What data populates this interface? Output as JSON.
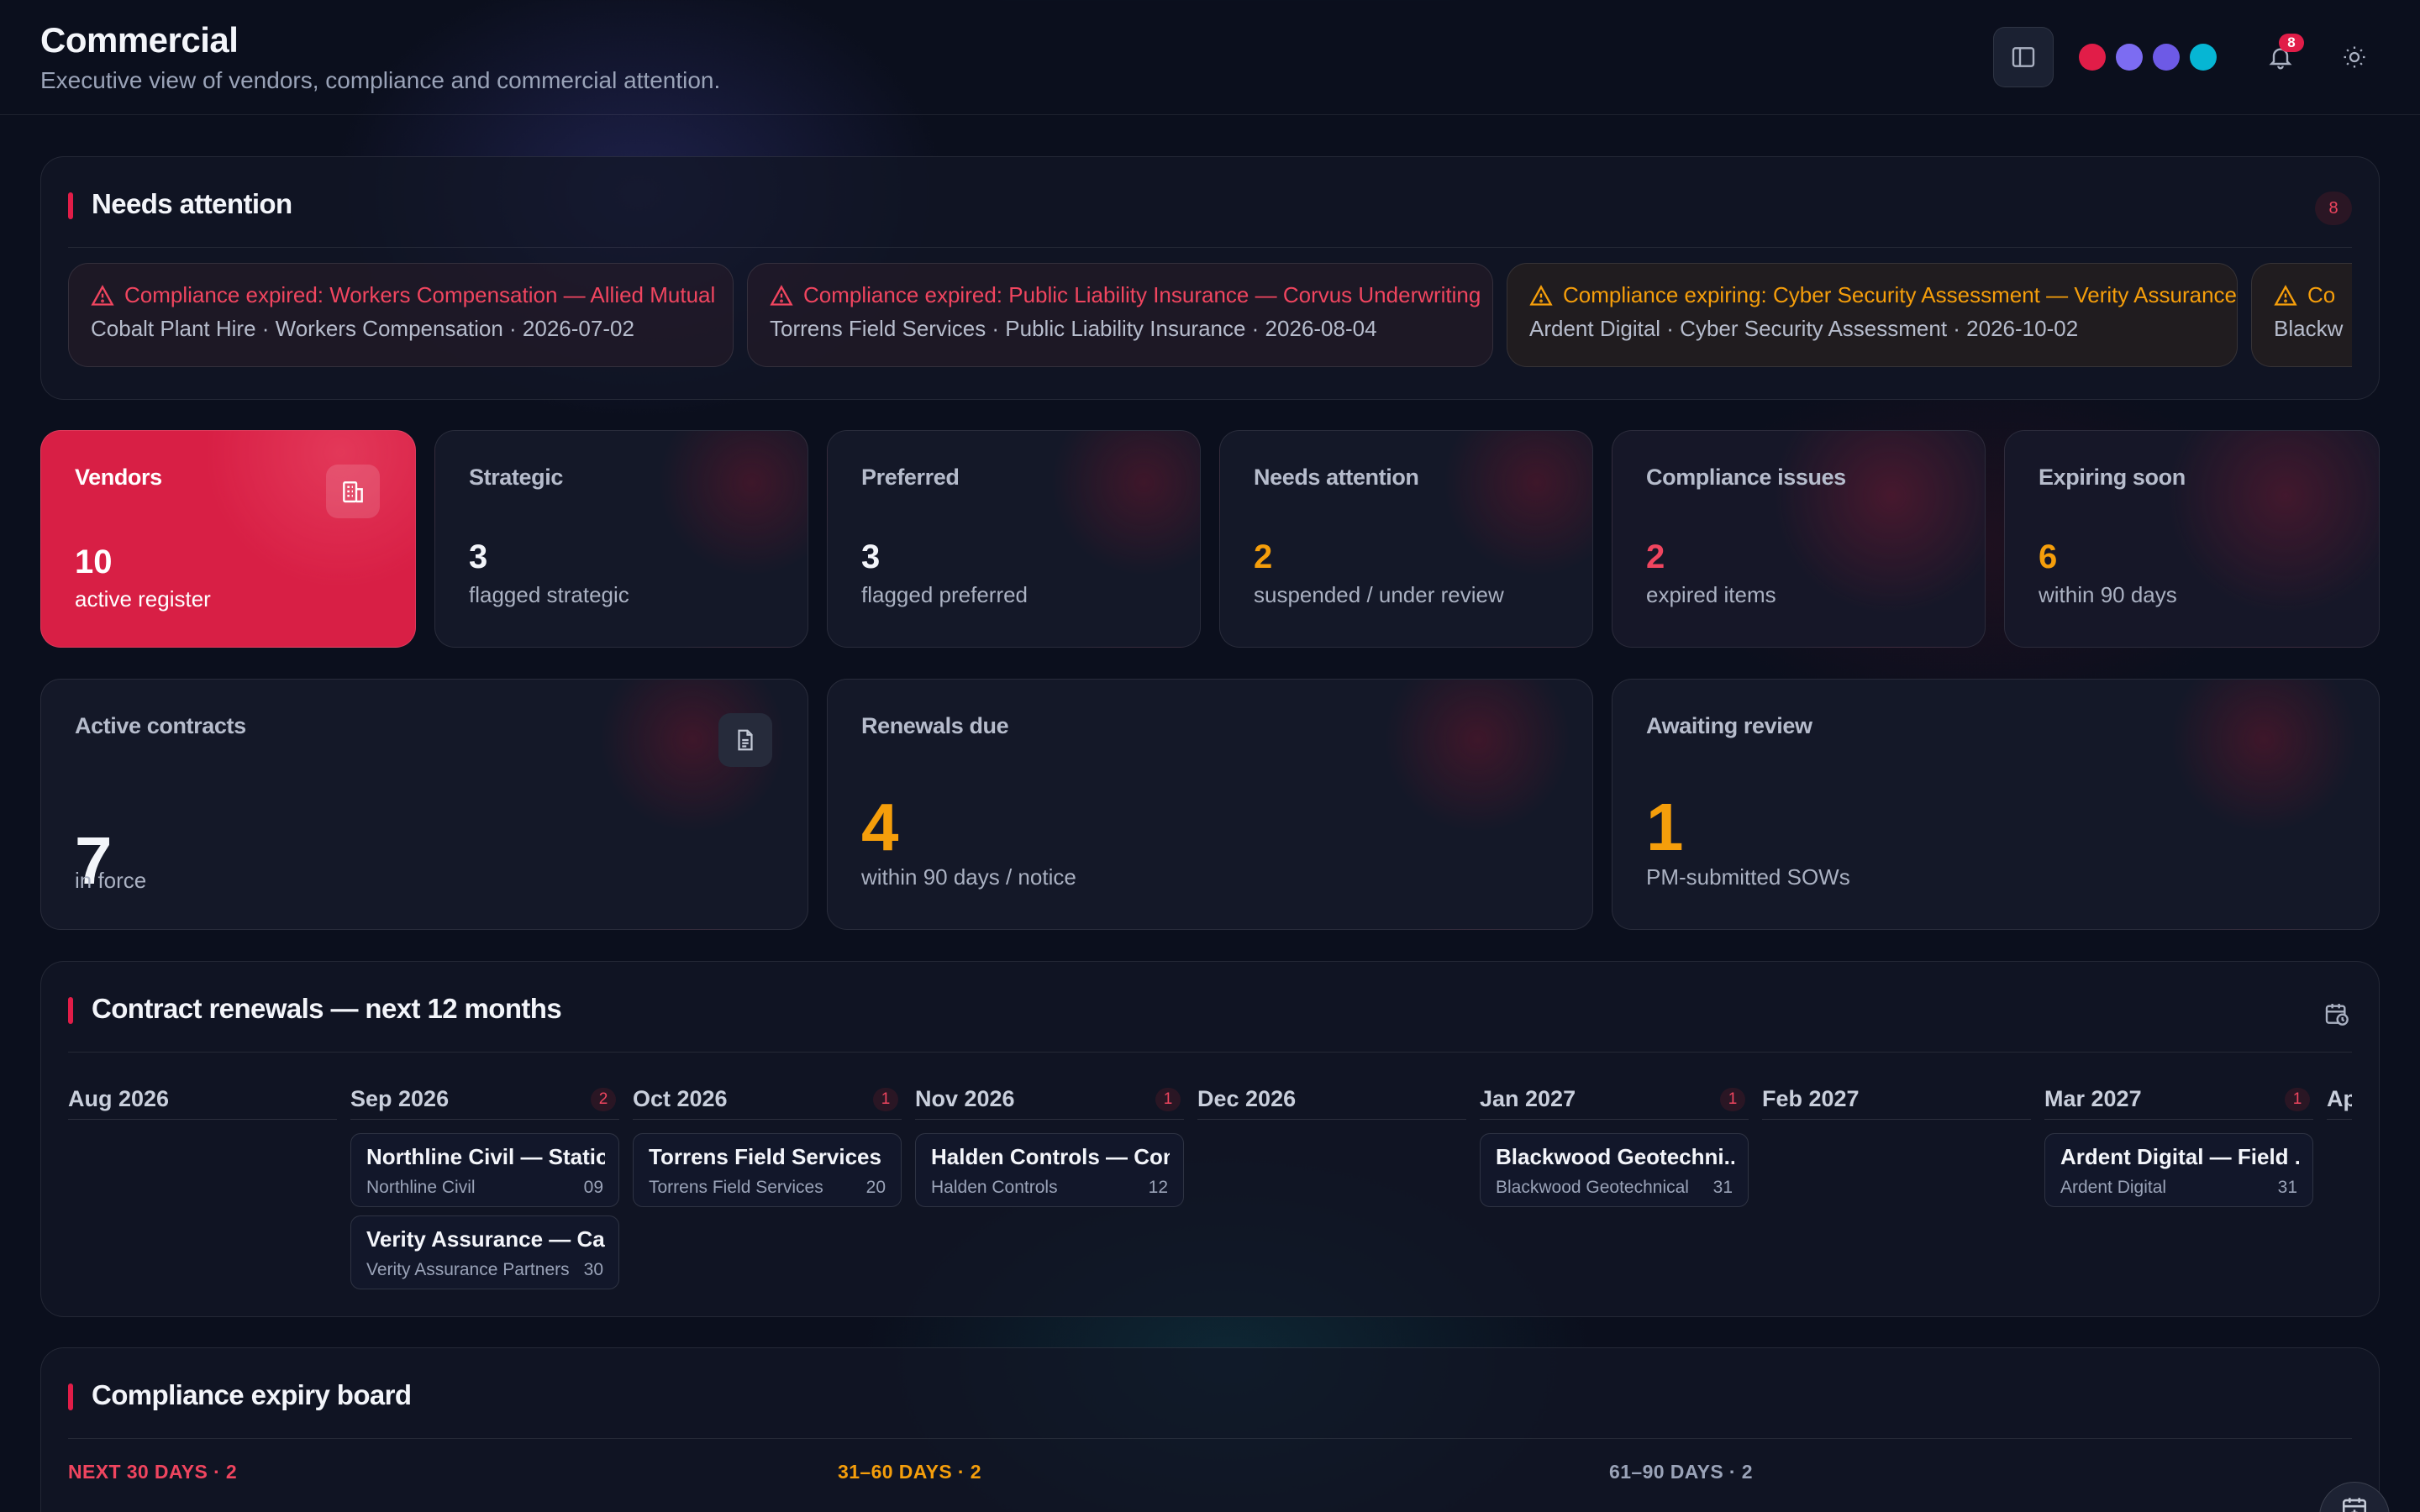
{
  "header": {
    "title": "Commercial",
    "subtitle": "Executive view of vendors, compliance and commercial attention.",
    "notification_count": "8",
    "theme_dots": [
      "#e11d48",
      "#7c6cf2",
      "#6d5ae6",
      "#06b6d4"
    ]
  },
  "attention": {
    "title": "Needs attention",
    "count": "8",
    "alerts": [
      {
        "title": "Compliance expired: Workers Compensation — Allied Mutual",
        "detail": "Cobalt Plant Hire · Workers Compensation · 2026-07-02",
        "status": "expired",
        "color": "#f0455f"
      },
      {
        "title": "Compliance expired: Public Liability Insurance — Corvus Underwriting",
        "detail": "Torrens Field Services · Public Liability Insurance · 2026-08-04",
        "status": "expired",
        "color": "#f0455f"
      },
      {
        "title": "Compliance expiring: Cyber Security Assessment — Verity Assurance",
        "detail": "Ardent Digital · Cyber Security Assessment · 2026-10-02",
        "status": "expiring",
        "color": "#f59e0b"
      },
      {
        "title": "Co",
        "detail": "Blackw",
        "status": "expiring",
        "color": "#f59e0b"
      }
    ]
  },
  "kpis": [
    {
      "label": "Vendors",
      "value": "10",
      "sub": "active register",
      "value_color": "#ffffff"
    },
    {
      "label": "Strategic",
      "value": "3",
      "sub": "flagged strategic",
      "value_color": "#f3f5fa"
    },
    {
      "label": "Preferred",
      "value": "3",
      "sub": "flagged preferred",
      "value_color": "#f3f5fa"
    },
    {
      "label": "Needs attention",
      "value": "2",
      "sub": "suspended / under review",
      "value_color": "#f59e0b"
    },
    {
      "label": "Compliance issues",
      "value": "2",
      "sub": "expired items",
      "value_color": "#f0455f"
    },
    {
      "label": "Expiring soon",
      "value": "6",
      "sub": "within 90 days",
      "value_color": "#f59e0b"
    }
  ],
  "contract_kpis": [
    {
      "label": "Active contracts",
      "value": "7",
      "sub": "in force",
      "value_color": "#f3f5fa"
    },
    {
      "label": "Renewals due",
      "value": "4",
      "sub": "within 90 days / notice",
      "value_color": "#f59e0b"
    },
    {
      "label": "Awaiting review",
      "value": "1",
      "sub": "PM-submitted SOWs",
      "value_color": "#f59e0b"
    }
  ],
  "renewals": {
    "title": "Contract renewals — next 12 months",
    "months": [
      {
        "name": "Aug 2026",
        "count": "",
        "items": []
      },
      {
        "name": "Sep 2026",
        "count": "2",
        "items": [
          {
            "title": "Northline Civil — Statio...",
            "vendor": "Northline Civil",
            "day": "09"
          },
          {
            "title": "Verity Assurance — Ca...",
            "vendor": "Verity Assurance Partners",
            "day": "30"
          }
        ]
      },
      {
        "name": "Oct 2026",
        "count": "1",
        "items": [
          {
            "title": "Torrens Field Services ...",
            "vendor": "Torrens Field Services",
            "day": "20"
          }
        ]
      },
      {
        "name": "Nov 2026",
        "count": "1",
        "items": [
          {
            "title": "Halden Controls — Con...",
            "vendor": "Halden Controls",
            "day": "12"
          }
        ]
      },
      {
        "name": "Dec 2026",
        "count": "",
        "items": []
      },
      {
        "name": "Jan 2027",
        "count": "1",
        "items": [
          {
            "title": "Blackwood Geotechni...",
            "vendor": "Blackwood Geotechnical",
            "day": "31"
          }
        ]
      },
      {
        "name": "Feb 2027",
        "count": "",
        "items": []
      },
      {
        "name": "Mar 2027",
        "count": "1",
        "items": [
          {
            "title": "Ardent Digital — Field ...",
            "vendor": "Ardent Digital",
            "day": "31"
          }
        ]
      },
      {
        "name": "Ap",
        "count": "",
        "items": []
      }
    ]
  },
  "compliance_board": {
    "title": "Compliance expiry board",
    "columns": [
      {
        "label": "NEXT 30 DAYS · 2",
        "color": "#f0455f"
      },
      {
        "label": "31–60 DAYS · 2",
        "color": "#f59e0b"
      },
      {
        "label": "61–90 DAYS · 2",
        "color": "#9aa3b8"
      }
    ]
  }
}
